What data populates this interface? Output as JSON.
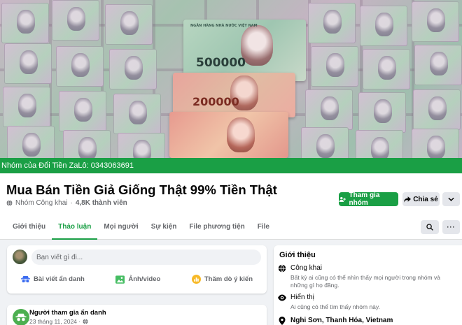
{
  "cover": {
    "denomination_top": "500000",
    "denomination_mid": "200000",
    "bank_text": "NGÂN HÀNG NHÀ NƯỚC VIỆT NAM"
  },
  "group_bar": {
    "text": "Nhóm của Đổi Tiền ZaLô: 0343063691"
  },
  "header": {
    "title": "Mua Bán Tiền Giả Giống Thật 99% Tiền Thật",
    "privacy": "Nhóm Công khai",
    "members": "4,8K thành viên",
    "join_label": "Tham gia nhóm",
    "share_label": "Chia sẻ"
  },
  "tabs": [
    {
      "label": "Giới thiệu",
      "active": false
    },
    {
      "label": "Thảo luận",
      "active": true
    },
    {
      "label": "Mọi người",
      "active": false
    },
    {
      "label": "Sự kiện",
      "active": false
    },
    {
      "label": "File phương tiện",
      "active": false
    },
    {
      "label": "File",
      "active": false
    }
  ],
  "composer": {
    "placeholder": "Bạn viết gì đi...",
    "actions": [
      {
        "label": "Bài viết ẩn danh",
        "icon": "incognito-icon"
      },
      {
        "label": "Ảnh/video",
        "icon": "photo-icon"
      },
      {
        "label": "Thăm dò ý kiến",
        "icon": "poll-icon"
      }
    ]
  },
  "post": {
    "author": "Người tham gia ẩn danh",
    "date": "23 tháng 11, 2024 ·"
  },
  "intro": {
    "title": "Giới thiệu",
    "items": [
      {
        "title": "Công khai",
        "desc": "Bất kỳ ai cũng có thể nhìn thấy mọi người trong nhóm và những gì họ đăng.",
        "icon": "globe-icon"
      },
      {
        "title": "Hiển thị",
        "desc": "Ai cũng có thể tìm thấy nhóm này.",
        "icon": "eye-icon"
      },
      {
        "title": "Nghi Sơn, Thanh Hóa, Vietnam",
        "desc": "",
        "icon": "location-pin-icon"
      }
    ]
  },
  "colors": {
    "brand_green": "#1a9f45",
    "background": "#f0f2f5"
  }
}
